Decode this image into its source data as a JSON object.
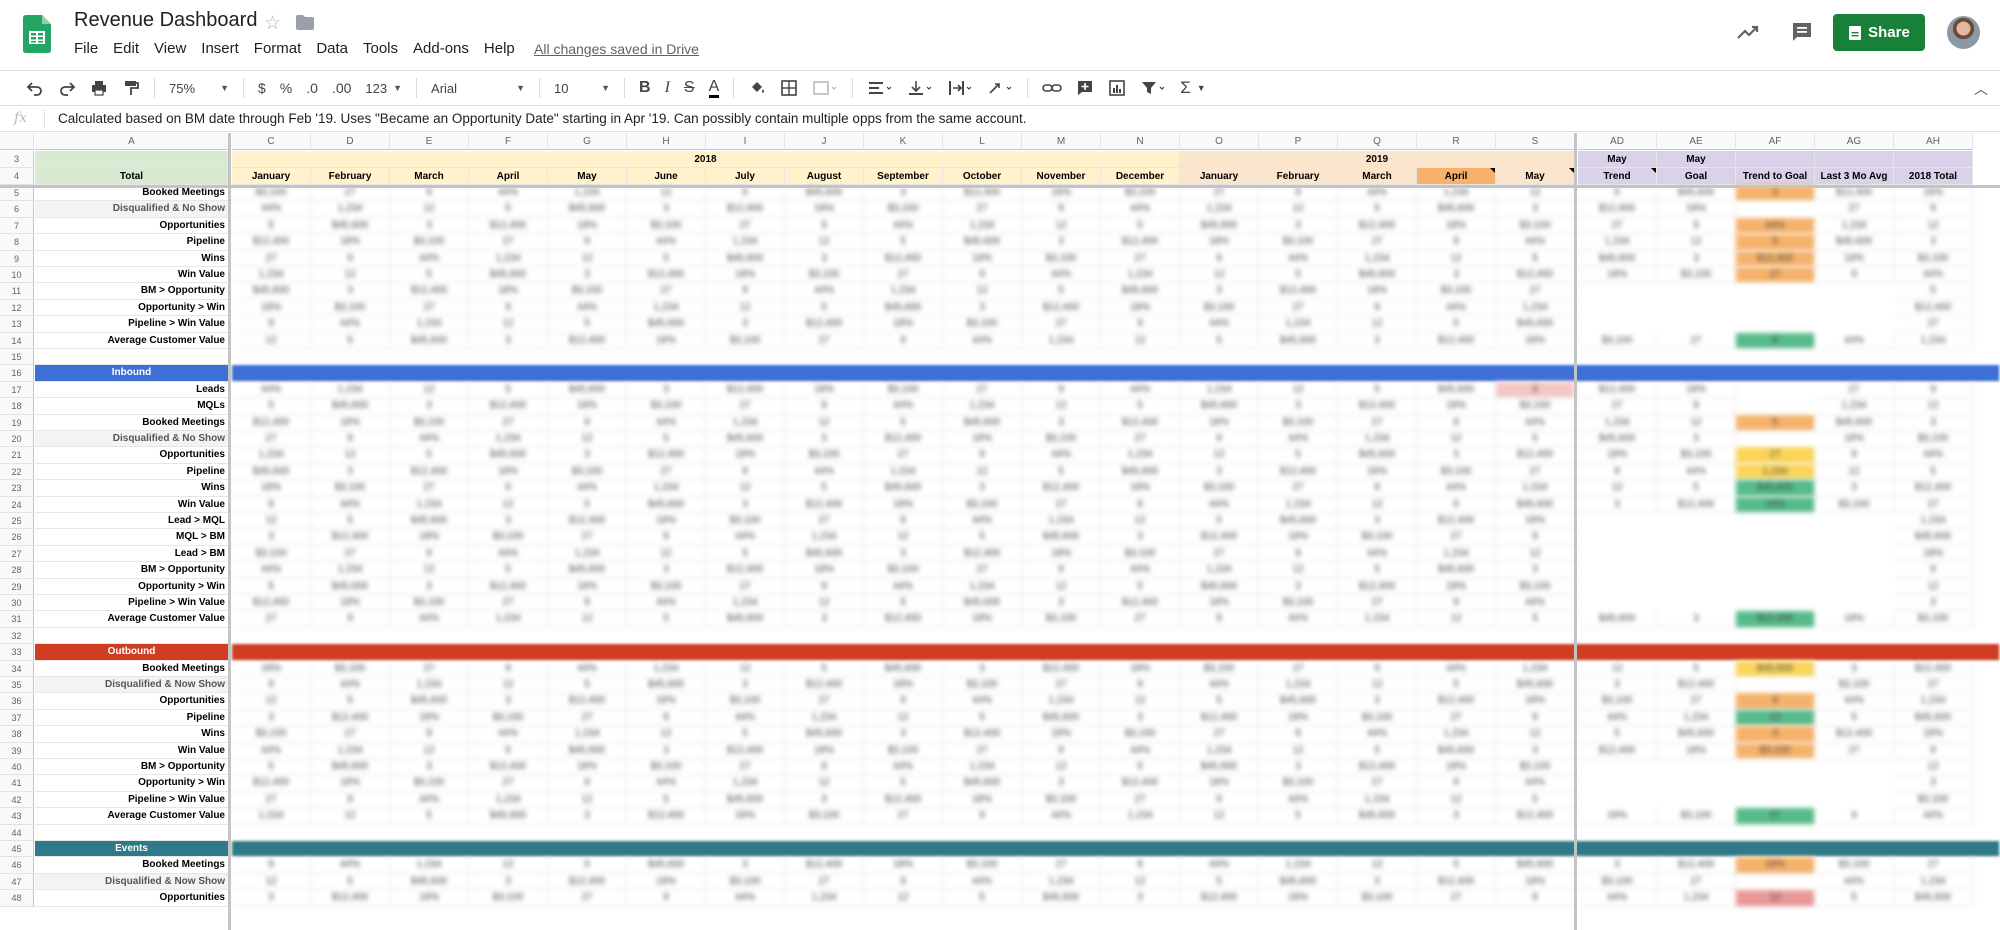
{
  "app": {
    "title": "Revenue Dashboard",
    "saved_status": "All changes saved in Drive",
    "share_label": "Share",
    "menu": [
      "File",
      "Edit",
      "View",
      "Insert",
      "Format",
      "Data",
      "Tools",
      "Add-ons",
      "Help"
    ]
  },
  "toolbar": {
    "zoom": "75%",
    "currency": "$",
    "percent": "%",
    "decrease_decimals": ".0",
    "increase_decimals": ".00",
    "more_formats": "123",
    "font": "Arial",
    "font_size": "10"
  },
  "formula_bar": {
    "fx": "fx",
    "content": "Calculated based on BM date through Feb '19. Uses \"Became an Opportunity Date\" starting in Apr '19. Can possibly contain multiple opps from the same account."
  },
  "columns": [
    "A",
    "C",
    "D",
    "E",
    "F",
    "G",
    "H",
    "I",
    "J",
    "K",
    "L",
    "M",
    "N",
    "O",
    "P",
    "Q",
    "R",
    "S",
    "AD",
    "AE",
    "AF",
    "AG",
    "AH"
  ],
  "header_row3": {
    "year_2018": "2018",
    "year_2019": "2019",
    "ad": "May",
    "ae": "May"
  },
  "header_row4": [
    "Total",
    "January",
    "February",
    "March",
    "April",
    "May",
    "June",
    "July",
    "August",
    "September",
    "October",
    "November",
    "December",
    "January",
    "February",
    "March",
    "April",
    "May",
    "Trend",
    "Goal",
    "Trend to Goal",
    "Last 3 Mo Avg",
    "2018 Total"
  ],
  "row_numbers": [
    "3",
    "4",
    "5",
    "6",
    "7",
    "8",
    "9",
    "10",
    "11",
    "12",
    "13",
    "14",
    "15",
    "16",
    "17",
    "18",
    "19",
    "20",
    "21",
    "22",
    "23",
    "24",
    "25",
    "26",
    "27",
    "28",
    "29",
    "30",
    "31",
    "32",
    "33",
    "34",
    "35",
    "36",
    "37",
    "38",
    "39",
    "40",
    "41",
    "42",
    "43",
    "44",
    "45",
    "46",
    "47",
    "48"
  ],
  "row_labels": {
    "5": "Booked Meetings",
    "6": "Disqualified & No Show",
    "7": "Opportunities",
    "8": "Pipeline",
    "9": "Wins",
    "10": "Win Value",
    "11": "BM > Opportunity",
    "12": "Opportunity > Win",
    "13": "Pipeline > Win Value",
    "14": "Average Customer Value",
    "15": "",
    "16": "Inbound",
    "17": "Leads",
    "18": "MQLs",
    "19": "Booked Meetings",
    "20": "Disqualified & No Show",
    "21": "Opportunities",
    "22": "Pipeline",
    "23": "Wins",
    "24": "Win Value",
    "25": "Lead > MQL",
    "26": "MQL > BM",
    "27": "Lead > BM",
    "28": "BM > Opportunity",
    "29": "Opportunity > Win",
    "30": "Pipeline > Win Value",
    "31": "Average Customer Value",
    "32": "",
    "33": "Outbound",
    "34": "Booked Meetings",
    "35": "Disqualified & Now Show",
    "36": "Opportunities",
    "37": "Pipeline",
    "38": "Wins",
    "39": "Win Value",
    "40": "BM > Opportunity",
    "41": "Opportunity > Win",
    "42": "Pipeline > Win Value",
    "43": "Average Customer Value",
    "44": "",
    "45": "Events",
    "46": "Booked Meetings",
    "47": "Disqualified & Now Show",
    "48": "Opportunities"
  },
  "section_colors": {
    "16": "#3d6fd6",
    "33": "#cf3d22",
    "45": "#2f7a8a"
  },
  "colors": {
    "share": "#188038",
    "year2018": "#fff2cc",
    "year2019": "#fce5cd",
    "april_2019": "#f6b26b",
    "may_cols": "#d9d2e9",
    "total_col": "#d9ead3"
  },
  "icons": [
    "sheets-logo-icon",
    "star-icon",
    "folder-icon",
    "trend-icon",
    "comment-icon",
    "share-lock-icon",
    "undo-icon",
    "redo-icon",
    "print-icon",
    "paint-format-icon",
    "bold-icon",
    "italic-icon",
    "strikethrough-icon",
    "text-color-icon",
    "fill-color-icon",
    "borders-icon",
    "merge-icon",
    "align-icon",
    "valign-icon",
    "wrap-icon",
    "rotate-icon",
    "link-icon",
    "comment-insert-icon",
    "chart-icon",
    "filter-icon",
    "functions-icon",
    "collapse-icon"
  ]
}
